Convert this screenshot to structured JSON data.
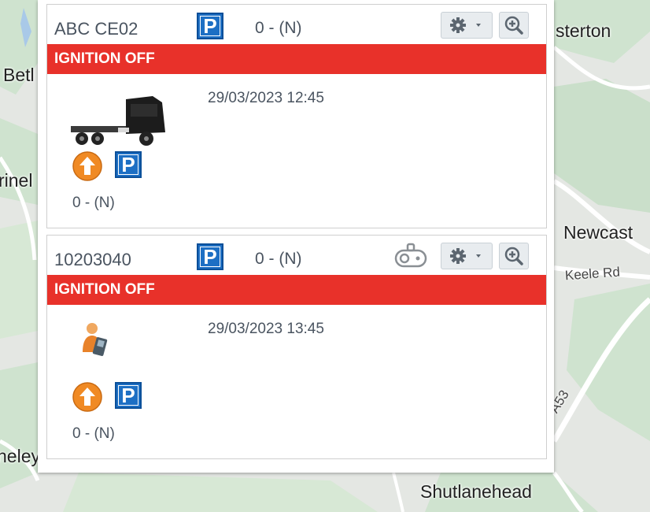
{
  "map": {
    "labels": [
      "sterton",
      "Betl",
      "rinel",
      "Newcast",
      "Shutlanehead",
      "neley"
    ],
    "roads": [
      "Keele Rd",
      "A53"
    ]
  },
  "cards": [
    {
      "name": "ABC CE02",
      "status_text": "0 - (N)",
      "banner": "IGNITION OFF",
      "timestamp": "29/03/2023 12:45",
      "body_status": "0 - (N)",
      "parking_letter": "P"
    },
    {
      "name": "10203040",
      "status_text": "0 - (N)",
      "banner": "IGNITION OFF",
      "timestamp": "29/03/2023 13:45",
      "body_status": "0 - (N)",
      "parking_letter": "P"
    }
  ],
  "colors": {
    "banner": "#e8312a",
    "parking": "#1d6fc4",
    "direction": "#f08a24"
  },
  "icons": [
    "parking-icon",
    "gear-icon",
    "zoom-icon",
    "truck-icon",
    "direction-icon",
    "dashcam-icon",
    "person-phone-icon"
  ]
}
